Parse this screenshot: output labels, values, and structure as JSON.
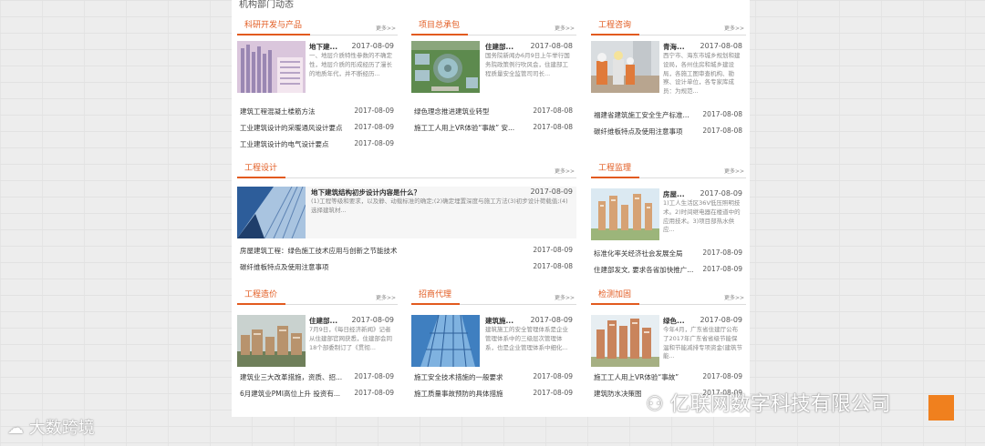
{
  "page_heading": "机构部门动态",
  "more_label": "更多>>",
  "sections": {
    "s1": {
      "title": "科研开发与产品",
      "feature": {
        "title": "地下建...",
        "date": "2017-08-09",
        "desc": "一、地层介质特性参数的不确定性，地层介质的形成经历了漫长的地质年代，并不断经历..."
      },
      "items": [
        {
          "title": "建筑工程混凝土楼筋方法",
          "date": "2017-08-09"
        },
        {
          "title": "工业建筑设计的采暖通风设计要点",
          "date": "2017-08-09"
        },
        {
          "title": "工业建筑设计的电气设计要点",
          "date": "2017-08-09"
        }
      ]
    },
    "s2": {
      "title": "项目总承包",
      "feature": {
        "title": "住建部...",
        "date": "2017-08-08",
        "desc": "国务院新闻办6月9日上午举行国务院政策例行吹风会，住建部工程质量安全监管司司长..."
      },
      "items": [
        {
          "title": "绿色理念推进建筑业转型",
          "date": "2017-08-08"
        },
        {
          "title": "施工工人用上VR体验“事故” 安...",
          "date": "2017-08-08"
        }
      ]
    },
    "s3": {
      "title": "工程咨询",
      "feature": {
        "title": "青海...",
        "date": "2017-08-08",
        "desc": "西宁市、海东市城乡规划和建设局，各州住房和城乡建设局，各施工图审查机构、勘察、设计单位，各专家库成员：为规范..."
      },
      "items": [
        {
          "title": "福建省建筑施工安全生产标准...",
          "date": "2017-08-08"
        },
        {
          "title": "碳纤维板特点及使用注意事项",
          "date": "2017-08-08"
        }
      ]
    },
    "s4": {
      "title": "工程设计",
      "feature": {
        "title": "地下建筑结构初步设计内容是什么？",
        "date": "2017-08-09",
        "desc": "(1)工程等级和要求，以及静、动载标准的确定;(2)确定埋置深度与施工方法(3)初步设计荷载值;(4)选择建筑材..."
      },
      "items": [
        {
          "title": "房屋建筑工程：绿色施工技术应用与创新之节能技术",
          "date": "2017-08-09"
        },
        {
          "title": "碳纤维板特点及使用注意事项",
          "date": "2017-08-08"
        }
      ]
    },
    "s5": {
      "title": "工程监理",
      "feature": {
        "title": "房屋...",
        "date": "2017-08-09",
        "desc": "1)工人生活区36V低压照明技术。2)时间继电器在楼道中的应用技术。3)项目部热水供应..."
      },
      "items": [
        {
          "title": "标准化率关经济社会发展全局",
          "date": "2017-08-09"
        },
        {
          "title": "住建部发文, 要求各省加快推广...",
          "date": "2017-08-09"
        }
      ]
    },
    "s6": {
      "title": "工程造价",
      "feature": {
        "title": "住建部...",
        "date": "2017-08-09",
        "desc": "7月9日，《每日经济新闻》记者从住建部官网获悉，住建部会同18个部委制订了《贯彻..."
      },
      "items": [
        {
          "title": "建筑业三大改革措施，资质、招...",
          "date": "2017-08-09"
        },
        {
          "title": "6月建筑业PMI高位上升 投资有...",
          "date": "2017-08-09"
        }
      ]
    },
    "s7": {
      "title": "招商代理",
      "feature": {
        "title": "建筑施...",
        "date": "2017-08-09",
        "desc": "建筑施工的安全管理体系是企业管理体系中的三级层次管理体系，也是企业管理体系中细化..."
      },
      "items": [
        {
          "title": "施工安全技术措施的一般要求",
          "date": "2017-08-09"
        },
        {
          "title": "施工质量事故预防的具体措施",
          "date": "2017-08-09"
        }
      ]
    },
    "s8": {
      "title": "检测加固",
      "feature": {
        "title": "绿色...",
        "date": "2017-08-09",
        "desc": "今年4月，广东省住建厅公布了2017年广东省省级节能保温和节能减排专项资金(建筑节能..."
      },
      "items": [
        {
          "title": "施工工人用上VR体验“事故”",
          "date": "2017-08-09"
        },
        {
          "title": "建筑防水决策图",
          "date": "2017-08-09"
        }
      ]
    }
  },
  "watermark_left": "大数跨境",
  "watermark_right": "亿联网数字科技有限公司",
  "colors": {
    "accent": "#e25a1f",
    "back_to_top": "#f0801e"
  }
}
